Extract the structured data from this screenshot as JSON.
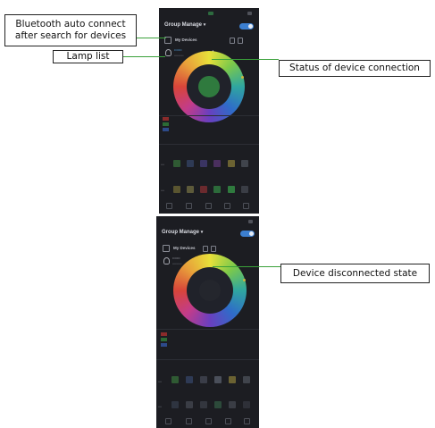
{
  "annotations": {
    "bluetooth_auto": "Bluetooth auto connect\nafter search for devices",
    "lamp_list": "Lamp list",
    "status_connection": "Status of device connection",
    "disconnected": "Device disconnected state"
  },
  "screen1": {
    "header_title": "Group Manage",
    "header_chevron": "▾",
    "devices_label": "My Devices",
    "lamp_name": "•••••••",
    "lamp_sub": "••••••••••"
  },
  "screen2": {
    "header_title": "Group Manage",
    "header_chevron": "▾",
    "devices_label": "My Devices",
    "lamp_name": "•••••••",
    "lamp_sub": "••••••••••"
  },
  "colors": {
    "accent_blue": "#3c7fd0",
    "leader_green": "#3aa13a",
    "phone_bg": "#1c1d22"
  }
}
